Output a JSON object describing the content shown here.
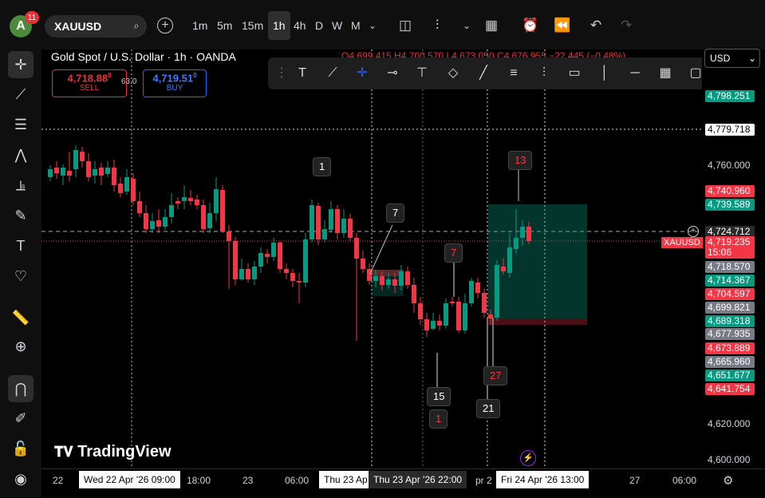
{
  "topbar": {
    "avatar_letter": "A",
    "notif_count": "11",
    "symbol": "XAUUSD",
    "timeframes": [
      "1m",
      "5m",
      "15m",
      "1h",
      "4h",
      "D",
      "W",
      "M"
    ],
    "active_timeframe": "1h"
  },
  "legend": {
    "title": "Gold Spot / U.S. Dollar · 1h · OANDA",
    "ohlc": "O4,699.415 H4,700.570 L4,673.050 C4,676.955 −22.445 (−0.48%)",
    "sell_price": "4,718.88",
    "sell_sup": "0",
    "sell_label": "SELL",
    "buy_price": "4,719.51",
    "buy_sup": "0",
    "buy_label": "BUY",
    "spread": "63.0"
  },
  "currency": "USD",
  "price_labels": [
    {
      "text": "4,798.251",
      "style": "green"
    },
    {
      "text": "4,779.718",
      "style": "white"
    },
    {
      "text": "4,760.000",
      "style": "plain"
    },
    {
      "text": "4,740.960",
      "style": "red"
    },
    {
      "text": "4,739.589",
      "style": "green"
    },
    {
      "text": "4,724.712",
      "style": "dark"
    },
    {
      "text": "4,719.235",
      "style": "red"
    },
    {
      "text": "15:06",
      "style": "red"
    },
    {
      "text": "4,718.570",
      "style": "grey"
    },
    {
      "text": "4,714.367",
      "style": "green"
    },
    {
      "text": "4,704.597",
      "style": "red"
    },
    {
      "text": "4,699.821",
      "style": "grey"
    },
    {
      "text": "4,689.318",
      "style": "green"
    },
    {
      "text": "4,677.935",
      "style": "grey"
    },
    {
      "text": "4,673.889",
      "style": "red"
    },
    {
      "text": "4,665.960",
      "style": "grey"
    },
    {
      "text": "4,651.677",
      "style": "green"
    },
    {
      "text": "4,641.754",
      "style": "red"
    },
    {
      "text": "4,620.000",
      "style": "plain"
    },
    {
      "text": "4,600.000",
      "style": "plain"
    }
  ],
  "symbol_tag": "XAUUSD",
  "time_labels": [
    "22",
    "18:00",
    "23",
    "06:00",
    "pr 2",
    "27",
    "06:00"
  ],
  "time_boxes": [
    "Wed 22 Apr '26   09:00",
    "Thu 23 Ap",
    "Thu 23 Apr '26   22:00",
    "Fri 24 Apr '26   13:00"
  ],
  "markers": [
    "1",
    "7",
    "7",
    "13",
    "27",
    "15",
    "1",
    "21"
  ],
  "brand": "TradingView",
  "colors": {
    "up": "#089981",
    "down": "#f23645",
    "accent": "#2962ff"
  }
}
